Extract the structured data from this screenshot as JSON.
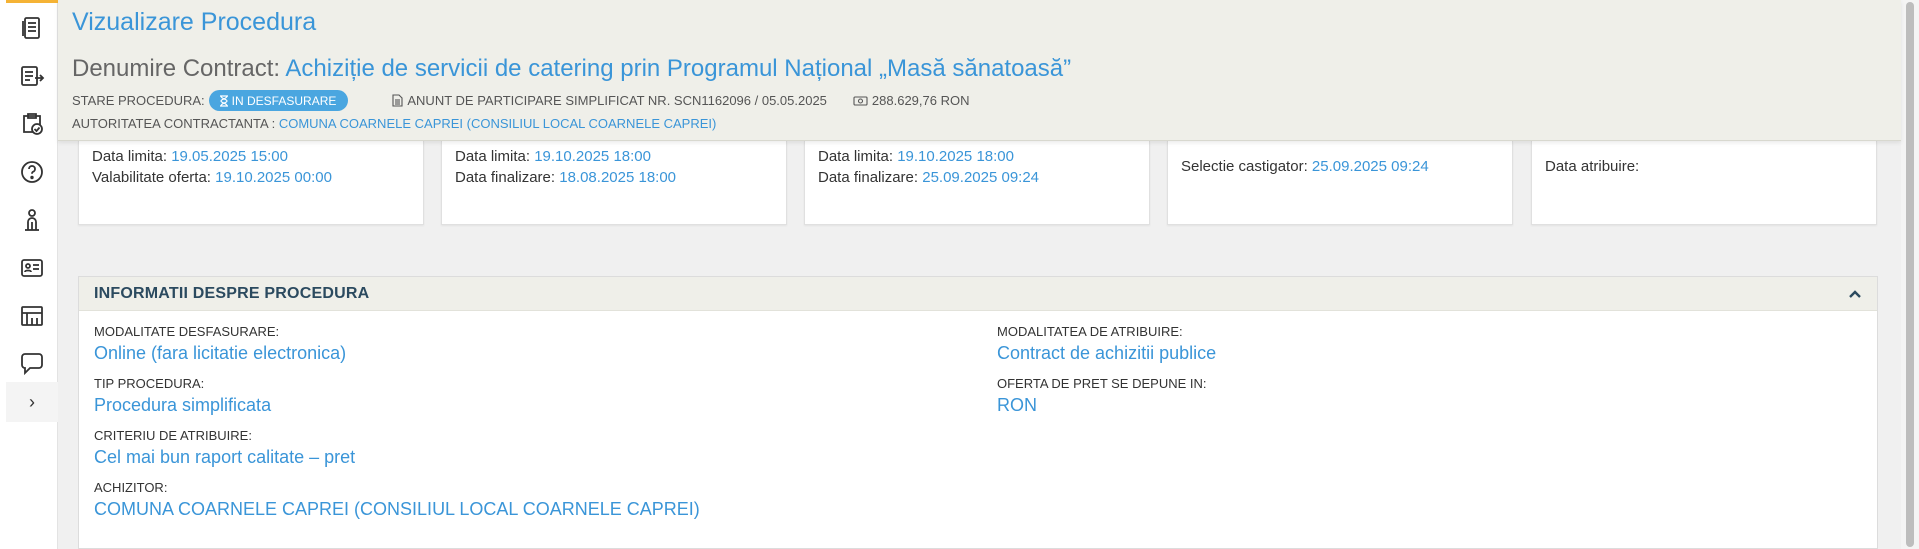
{
  "header": {
    "title": "Vizualizare Procedura",
    "contract_label": "Denumire Contract:",
    "contract_value": "Achiziție de servicii de catering prin Programul Național „Masă sănatoasă”",
    "stare_label": "STARE PROCEDURA:",
    "stare_badge": "IN DESFASURARE",
    "anunt": "ANUNT DE PARTICIPARE SIMPLIFICAT NR. SCN1162096 / 05.05.2025",
    "value": "288.629,76",
    "currency": "RON",
    "autoritate_label": "AUTORITATEA CONTRACTANTA :",
    "autoritate_value": "COMUNA COARNELE CAPREI (CONSILIUL LOCAL COARNELE CAPREI)"
  },
  "sidebar": {
    "icons": [
      "document-icon",
      "export-document-icon",
      "clipboard-check-icon",
      "help-icon",
      "person-icon",
      "id-card-icon",
      "ticket-icon",
      "chat-icon"
    ],
    "expand": "›"
  },
  "cards": [
    {
      "l1_label": "Data limita:",
      "l1_value": "19.05.2025 15:00",
      "l2_label": "Valabilitate oferta:",
      "l2_value": "19.10.2025 00:00"
    },
    {
      "l1_label": "Data limita:",
      "l1_value": "19.10.2025 18:00",
      "l2_label": "Data finalizare:",
      "l2_value": "18.08.2025 18:00"
    },
    {
      "l1_label": "Data limita:",
      "l1_value": "19.10.2025 18:00",
      "l2_label": "Data finalizare:",
      "l2_value": "25.09.2025 09:24"
    },
    {
      "c_label": "Selectie castigator:",
      "c_value": "25.09.2025 09:24"
    },
    {
      "c_label": "Data atribuire:",
      "c_value": ""
    }
  ],
  "panel": {
    "title": "INFORMATII DESPRE PROCEDURA",
    "fields": [
      {
        "label": "MODALITATE DESFASURARE:",
        "value": "Online (fara licitatie electronica)"
      },
      {
        "label": "MODALITATEA DE ATRIBUIRE:",
        "value": "Contract de achizitii publice"
      },
      {
        "label": "TIP PROCEDURA:",
        "value": "Procedura simplificata"
      },
      {
        "label": "OFERTA DE PRET SE DEPUNE IN:",
        "value": "RON"
      },
      {
        "label": "CRITERIU DE ATRIBUIRE:",
        "value": "Cel mai bun raport calitate – pret"
      },
      {
        "label": "ACHIZITOR:",
        "value": "COMUNA COARNELE CAPREI (CONSILIUL LOCAL COARNELE CAPREI)"
      }
    ]
  },
  "colors": {
    "accent": "#3a95d8",
    "header_bg": "#efefe9",
    "badge": "#4aa6e0",
    "sidebar_marker": "#f5b335"
  }
}
